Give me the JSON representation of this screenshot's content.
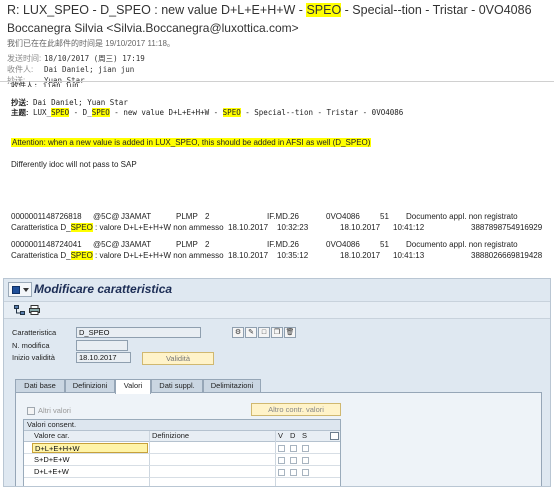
{
  "email": {
    "subject": {
      "prefix": "R: LUX_SPEO - D_SPEO : new value D+L+E+H+W - ",
      "highlight": "SPEO",
      "suffix": " - Special--tion - Tristar - 0VO4086"
    },
    "sender": "Boccanegra Silvia <Silvia.Boccanegra@luxottica.com>",
    "notice": "我们已在在此邮件的时间是 19/10/2017 11:18。",
    "header_rows": [
      {
        "label": "发送时间:",
        "value": "18/10/2017 (周三) 17:19"
      },
      {
        "label": "收件人:",
        "value": "Dai Daniel; jian jun"
      },
      {
        "label": "抄送:",
        "value": "Yuan Star"
      }
    ]
  },
  "quoted": {
    "partial": "收件人: jian jun",
    "cc_label": "抄送:",
    "cc_value": " Dai Daniel; Yuan Star",
    "subject_label": "主题:",
    "subject_a": " LUX_",
    "subject_hl1": "SPEO",
    "subject_b": " - D_",
    "subject_hl2": "SPEO",
    "subject_c": " - new value D+L+E+H+W - ",
    "subject_hl3": "SPEO",
    "subject_d": " - Special--tion - Tristar - 0VO4086"
  },
  "body": {
    "attention": "Attention: when a new value is added in LUX_SPEO, this should be added in AFSI as well (D_SPEO)",
    "idoc": "Differently idoc will not pass to SAP"
  },
  "log_rows": [
    {
      "id": "0000001148726818",
      "b": "@5C@",
      "c": "J3AMAT",
      "d": "PLMP",
      "e": "2",
      "f": "IF.MD.26",
      "g": "0VO4086",
      "h": "51",
      "i": "Documento appl. non registrato"
    },
    {
      "a1": "Caratteristica D_",
      "a2": "SPEO",
      "a3": " : valore D+L+E+H+W non ammesso",
      "date": "18.10.2017",
      "t1": "10:32:23",
      "date2": "18.10.2017",
      "t2": "10:41:12",
      "num": "3887898754916929"
    },
    {
      "id": "0000001148724041",
      "b": "@5C@",
      "c": "J3AMAT",
      "d": "PLMP",
      "e": "2",
      "f": "IF.MD.26",
      "g": "0VO4086",
      "h": "51",
      "i": "Documento appl. non registrato"
    },
    {
      "a1": "Caratteristica D_",
      "a2": "SPEO",
      "a3": " : valore D+L+E+H+W non ammesso",
      "date": "18.10.2017",
      "t1": "10:35:12",
      "date2": "18.10.2017",
      "t2": "10:41:13",
      "num": "3888026669819428"
    }
  ],
  "sap": {
    "title": "Modificare caratteristica",
    "fields": {
      "caratteristica_label": "Caratteristica",
      "caratteristica_value": "D_SPEO",
      "modifica_label": "N. modifica",
      "validita_label": "Inizio validità",
      "validita_value": "18.10.2017",
      "validita_button": "Validità"
    },
    "tabs": [
      "Dati base",
      "Definizioni",
      "Valori",
      "Dati suppl.",
      "Delimitazioni"
    ],
    "active_tab": "Valori",
    "altri_valori": "Altri valori",
    "altro_button": "Altro contr. valori",
    "grid": {
      "title": "Valori consent.",
      "headers": {
        "col1": "Valore car.",
        "col2": "Definizione",
        "v": "V",
        "d": "D",
        "s": "S"
      },
      "rows": [
        "D+L+E+H+W",
        "S+D+E+W",
        "D+L+E+W"
      ]
    }
  }
}
